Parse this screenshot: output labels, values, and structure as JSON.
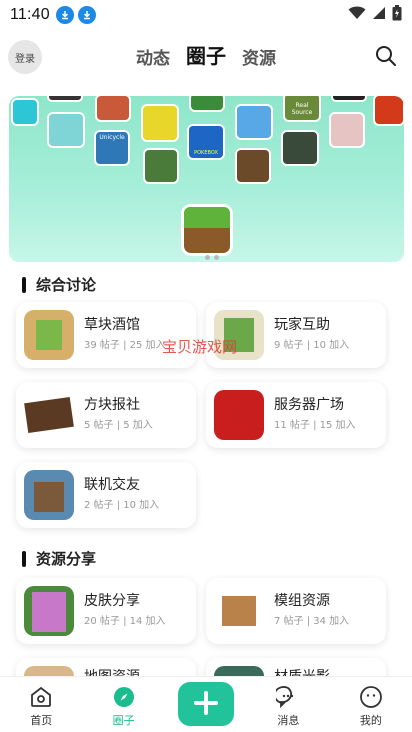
{
  "status_bar": {
    "time": "11:40"
  },
  "header": {
    "login_label": "登录",
    "tabs": [
      {
        "label": "动态",
        "active": false
      },
      {
        "label": "圈子",
        "active": true
      },
      {
        "label": "资源",
        "active": false
      }
    ]
  },
  "banner": {
    "tile_labels": [
      "Unicycle",
      "Real Source",
      "POKEBOX"
    ]
  },
  "sections": [
    {
      "title": "综合讨论",
      "items": [
        {
          "name": "草块酒馆",
          "meta": "39 帖子 | 25 加入"
        },
        {
          "name": "玩家互助",
          "meta": "9 帖子 | 10 加入"
        },
        {
          "name": "方块报社",
          "meta": "5 帖子 | 5 加入"
        },
        {
          "name": "服务器广场",
          "meta": "11 帖子 | 15 加入"
        },
        {
          "name": "联机交友",
          "meta": "2 帖子 | 10 加入"
        }
      ]
    },
    {
      "title": "资源分享",
      "items": [
        {
          "name": "皮肤分享",
          "meta": "20 帖子 | 14 加入"
        },
        {
          "name": "模组资源",
          "meta": "7 帖子 | 34 加入"
        },
        {
          "name": "地图资源",
          "meta": ""
        },
        {
          "name": "材质光影",
          "meta": ""
        }
      ]
    }
  ],
  "watermark": "宝贝游戏网",
  "bottom_nav": [
    {
      "label": "首页",
      "icon": "home-icon"
    },
    {
      "label": "圈子",
      "icon": "compass-icon",
      "active": true
    },
    {
      "label": "",
      "icon": "plus-icon"
    },
    {
      "label": "消息",
      "icon": "chat-icon"
    },
    {
      "label": "我的",
      "icon": "profile-icon"
    }
  ],
  "colors": {
    "accent": "#1bbd8f",
    "fab": "#22c39b",
    "banner": "#a6eed9"
  }
}
